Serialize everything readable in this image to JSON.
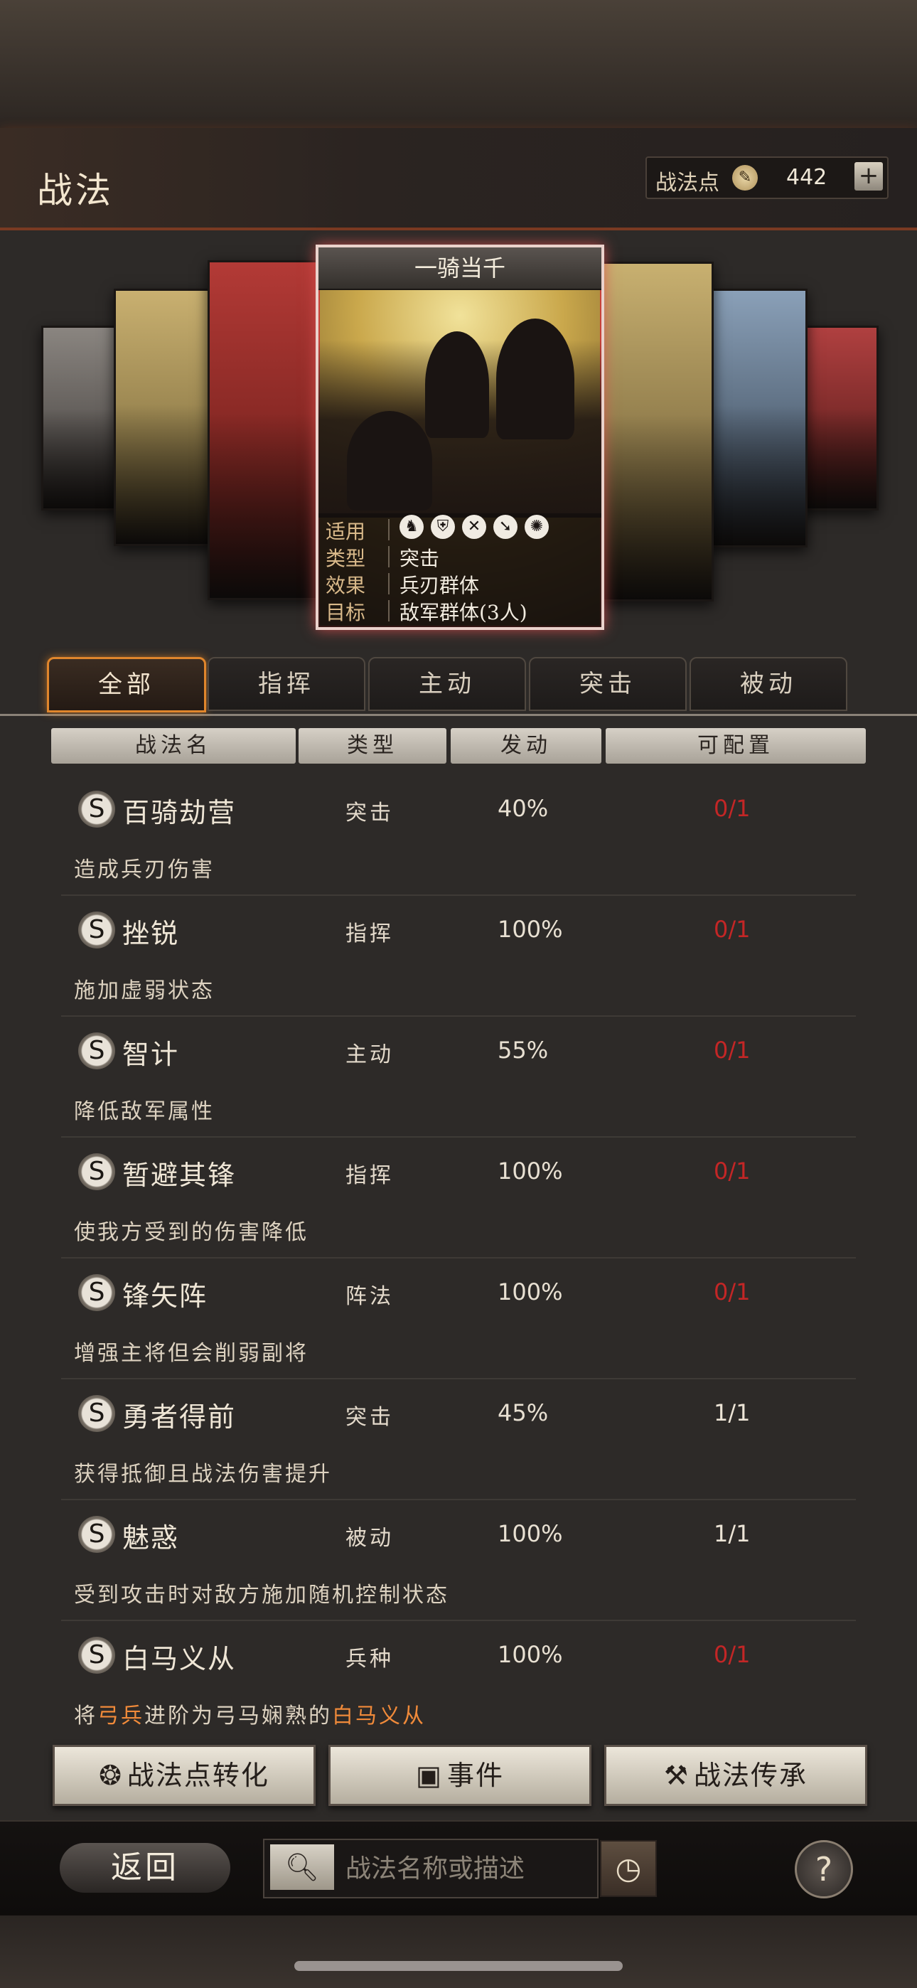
{
  "header": {
    "title": "战法",
    "points_label": "战法点",
    "points_value": "442",
    "plus_label": "+"
  },
  "featured": {
    "name": "一骑当千",
    "info": [
      {
        "key": "适用",
        "value": ""
      },
      {
        "key": "类型",
        "value": "突击"
      },
      {
        "key": "效果",
        "value": "兵刃群体"
      },
      {
        "key": "目标",
        "value": "敌军群体(3人)"
      }
    ],
    "troop_icons": [
      "cavalry-icon",
      "shield-icon",
      "bow-icon",
      "spear-icon",
      "chariot-icon"
    ]
  },
  "tabs": [
    "全部",
    "指挥",
    "主动",
    "突击",
    "被动"
  ],
  "columns": [
    "战法名",
    "类型",
    "发动",
    "可配置"
  ],
  "rows": [
    {
      "badge": "S",
      "name": "百骑劫营",
      "type": "突击",
      "rate": "40%",
      "slots": "0/1",
      "desc": "造成兵刃伤害"
    },
    {
      "badge": "S",
      "name": "挫锐",
      "type": "指挥",
      "rate": "100%",
      "slots": "0/1",
      "desc": "施加虚弱状态"
    },
    {
      "badge": "S",
      "name": "智计",
      "type": "主动",
      "rate": "55%",
      "slots": "0/1",
      "desc": "降低敌军属性"
    },
    {
      "badge": "S",
      "name": "暂避其锋",
      "type": "指挥",
      "rate": "100%",
      "slots": "0/1",
      "desc": "使我方受到的伤害降低"
    },
    {
      "badge": "S",
      "name": "锋矢阵",
      "type": "阵法",
      "rate": "100%",
      "slots": "0/1",
      "desc": "增强主将但会削弱副将"
    },
    {
      "badge": "S",
      "name": "勇者得前",
      "type": "突击",
      "rate": "45%",
      "slots": "1/1",
      "desc": "获得抵御且战法伤害提升"
    },
    {
      "badge": "S",
      "name": "魅惑",
      "type": "被动",
      "rate": "100%",
      "slots": "1/1",
      "desc": "受到攻击时对敌方施加随机控制状态"
    },
    {
      "badge": "S",
      "name": "白马义从",
      "type": "兵种",
      "rate": "100%",
      "slots": "0/1",
      "desc_parts": [
        "将",
        "弓兵",
        "进阶为弓马娴熟的",
        "白马义从"
      ]
    }
  ],
  "actions": {
    "convert": "战法点转化",
    "events": "事件",
    "inherit": "战法传承"
  },
  "bottom": {
    "back": "返回",
    "search_placeholder": "战法名称或描述",
    "help": "?"
  },
  "colors": {
    "accent": "#e0862c",
    "slots_unavailable": "#c32626",
    "highlight": "#f08a3a"
  }
}
